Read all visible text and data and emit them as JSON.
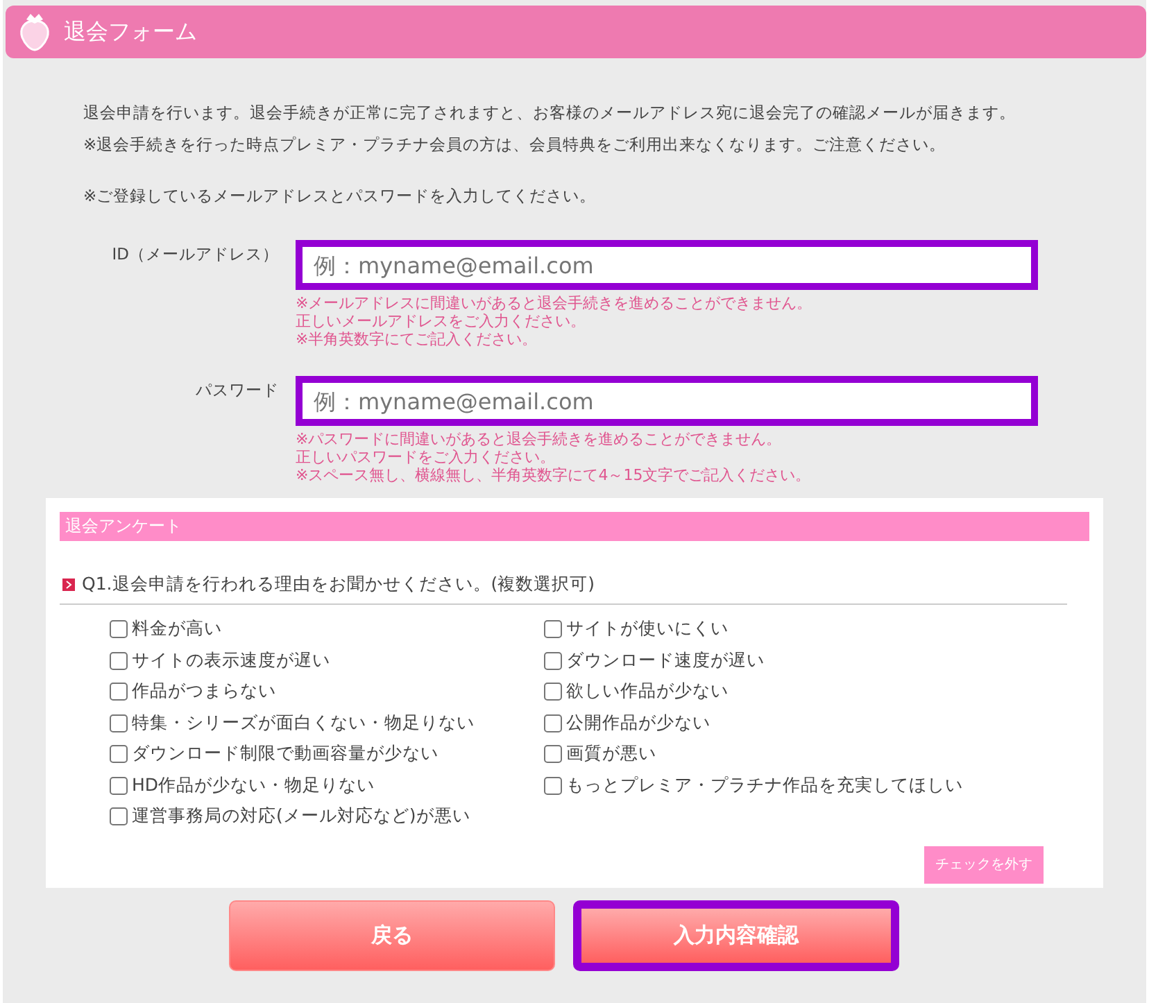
{
  "header": {
    "title": "退会フォーム"
  },
  "intro": [
    "退会申請を行います。退会手続きが正常に完了されますと、お客様のメールアドレス宛に退会完了の確認メールが届きます。",
    "※退会手続きを行った時点プレミア・プラチナ会員の方は、会員特典をご利用出来なくなります。ご注意ください。"
  ],
  "instruction": "※ご登録しているメールアドレスとパスワードを入力してください。",
  "fields": [
    {
      "label": "ID（メールアドレス）",
      "placeholder": "例：myname@email.com",
      "highlighted": true,
      "notes": [
        "※メールアドレスに間違いがあると退会手続きを進めることができません。",
        "正しいメールアドレスをご入力ください。",
        "※半角英数字にてご記入ください。"
      ]
    },
    {
      "label": "パスワード",
      "placeholder": "例：myname@email.com",
      "highlighted": true,
      "notes": [
        "※パスワードに間違いがあると退会手続きを進めることができません。",
        "正しいパスワードをご入力ください。",
        "※スペース無し、横線無し、半角英数字にて4～15文字でご記入ください。"
      ]
    }
  ],
  "survey": {
    "title": "退会アンケート",
    "question": "Q1.退会申請を行われる理由をお聞かせください。(複数選択可)",
    "options": [
      {
        "label": "料金が高い",
        "checked": false
      },
      {
        "label": "サイトが使いにくい",
        "checked": false
      },
      {
        "label": "サイトの表示速度が遅い",
        "checked": false
      },
      {
        "label": "ダウンロード速度が遅い",
        "checked": false
      },
      {
        "label": "作品がつまらない",
        "checked": false
      },
      {
        "label": "欲しい作品が少ない",
        "checked": false
      },
      {
        "label": "特集・シリーズが面白くない・物足りない",
        "checked": false
      },
      {
        "label": "公開作品が少ない",
        "checked": false
      },
      {
        "label": "ダウンロード制限で動画容量が少ない",
        "checked": false
      },
      {
        "label": "画質が悪い",
        "checked": false
      },
      {
        "label": "HD作品が少ない・物足りない",
        "checked": false
      },
      {
        "label": "もっとプレミア・プラチナ作品を充実してほしい",
        "checked": false
      },
      {
        "label": "運営事務局の対応(メール対応など)が悪い",
        "checked": false
      }
    ],
    "clear_button": "チェックを外す"
  },
  "buttons": [
    {
      "label": "戻る",
      "highlighted": false
    },
    {
      "label": "入力内容確認",
      "highlighted": true
    }
  ]
}
